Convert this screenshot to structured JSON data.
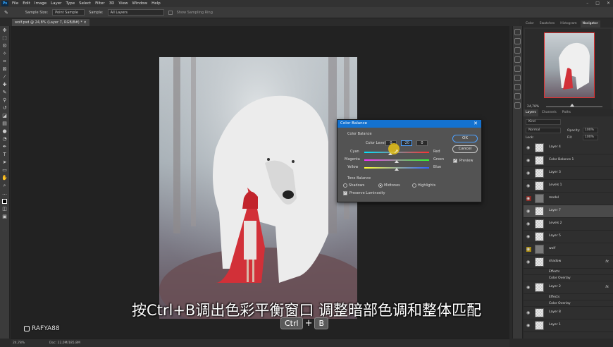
{
  "menu": [
    "File",
    "Edit",
    "Image",
    "Layer",
    "Type",
    "Select",
    "Filter",
    "3D",
    "View",
    "Window",
    "Help"
  ],
  "options": {
    "sample_size_label": "Sample Size:",
    "sample_size_value": "Point Sample",
    "sample_label": "Sample:",
    "sample_value": "All Layers",
    "show_ring": "Show Sampling Ring"
  },
  "document_tab": "wolf.psd @ 24,8% (Layer 7, RGB/8#) *",
  "dialog": {
    "title": "Color Balance",
    "section1": "Color Balance",
    "levels_label": "Color Levels:",
    "levels": [
      "0",
      "-20",
      "0"
    ],
    "sliders": [
      {
        "left": "Cyan",
        "right": "Red",
        "value": -20
      },
      {
        "left": "Magenta",
        "right": "Green",
        "value": 0
      },
      {
        "left": "Yellow",
        "right": "Blue",
        "value": 0
      }
    ],
    "section2": "Tone Balance",
    "tones": [
      "Shadows",
      "Midtones",
      "Highlights"
    ],
    "preserve": "Preserve Luminosity",
    "ok": "OK",
    "cancel": "Cancel",
    "preview": "Preview"
  },
  "panel_tabs": [
    "Color",
    "Swatches",
    "Histogram",
    "Navigator"
  ],
  "nav_zoom": "24,78%",
  "layers_tabs": [
    "Layers",
    "Channels",
    "Paths"
  ],
  "layers_filter": "Kind",
  "blend_mode": "Normal",
  "opacity_label": "Opacity:",
  "opacity_value": "100%",
  "fill_label": "Fill:",
  "fill_value": "100%",
  "lock_label": "Lock:",
  "layers": [
    {
      "name": "Layer 4",
      "fx": false
    },
    {
      "name": "Color Balance 1",
      "fx": false
    },
    {
      "name": "Layer 3",
      "fx": false
    },
    {
      "name": "Levels 1",
      "fx": false
    },
    {
      "name": "model",
      "fx": false
    },
    {
      "name": "Layer 7",
      "fx": false
    },
    {
      "name": "Levels 2",
      "fx": false
    },
    {
      "name": "Layer 5",
      "fx": false
    },
    {
      "name": "wolf",
      "fx": false
    },
    {
      "name": "shadow",
      "fx": true
    },
    {
      "name": "Effects",
      "fx": false
    },
    {
      "name": "Color Overlay",
      "fx": false
    },
    {
      "name": "Layer 2",
      "fx": true
    },
    {
      "name": "Effects",
      "fx": false
    },
    {
      "name": "Color Overlay",
      "fx": false
    },
    {
      "name": "Layer 8",
      "fx": false
    },
    {
      "name": "Layer 1",
      "fx": false
    }
  ],
  "fx_glyph": "fx",
  "status": {
    "zoom": "24,78%",
    "doc": "Doc: 22,0M/185,8M"
  },
  "subtitle": "按Ctrl+B调出色彩平衡窗口 调整暗部色调和整体匹配",
  "keys": [
    "Ctrl",
    "B"
  ],
  "watermark": "RAFYA88",
  "colors": {
    "accent": "#1472d0",
    "selection": "#ff0000"
  }
}
